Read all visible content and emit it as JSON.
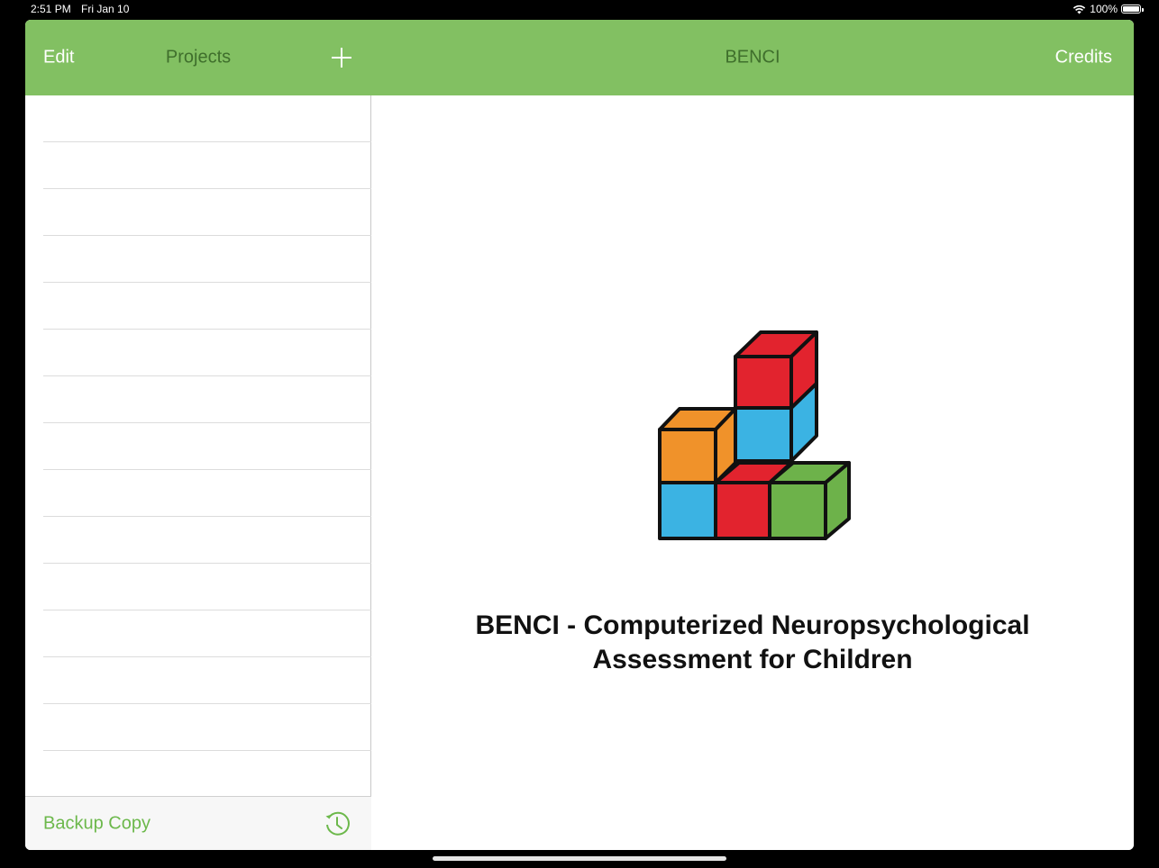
{
  "status": {
    "time": "2:51 PM",
    "date": "Fri Jan 10",
    "battery": "100%",
    "battery_level": 1.0
  },
  "master": {
    "edit_label": "Edit",
    "title": "Projects",
    "add_icon": "plus-icon",
    "rows": [
      "",
      "",
      "",
      "",
      "",
      "",
      "",
      "",
      "",
      "",
      "",
      "",
      "",
      "",
      ""
    ],
    "toolbar": {
      "backup_label": "Backup Copy",
      "history_icon": "history-icon"
    }
  },
  "detail": {
    "title": "BENCI",
    "credits_label": "Credits",
    "headline_line1": "BENCI - Computerized Neuropsychological",
    "headline_line2": "Assessment for Children"
  },
  "colors": {
    "nav_bar": "#82c062",
    "nav_title": "#3f6f2c",
    "accent": "#6cb84b",
    "cube_orange": "#f0922a",
    "cube_blue": "#3bb3e3",
    "cube_red": "#e2232e",
    "cube_green": "#6db24a"
  }
}
